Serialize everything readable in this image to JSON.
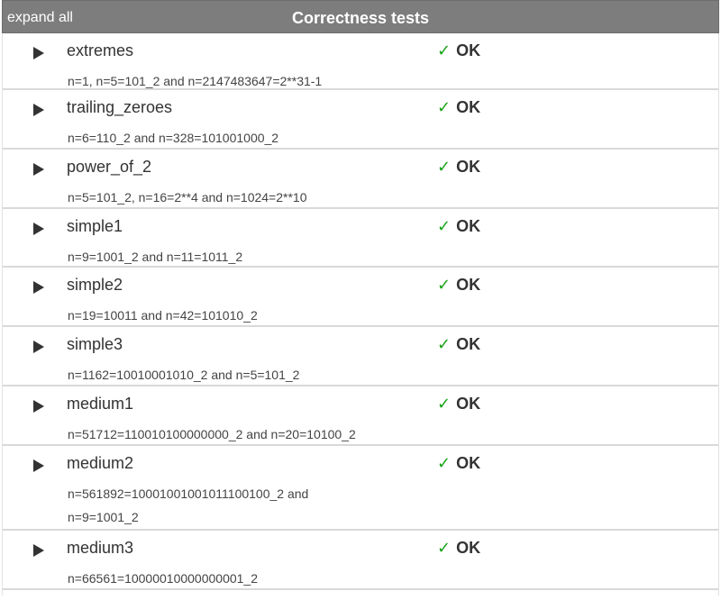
{
  "header": {
    "expand_all": "expand all",
    "title": "Correctness tests"
  },
  "check_icon": "✓",
  "tests": [
    {
      "name": "extremes",
      "desc": "n=1, n=5=101_2 and n=2147483647=2**31-1",
      "status": "OK"
    },
    {
      "name": "trailing_zeroes",
      "desc": "n=6=110_2 and n=328=101001000_2",
      "status": "OK"
    },
    {
      "name": "power_of_2",
      "desc": "n=5=101_2, n=16=2**4 and n=1024=2**10",
      "status": "OK"
    },
    {
      "name": "simple1",
      "desc": "n=9=1001_2 and n=11=1011_2",
      "status": "OK"
    },
    {
      "name": "simple2",
      "desc": "n=19=10011 and n=42=101010_2",
      "status": "OK"
    },
    {
      "name": "simple3",
      "desc": "n=1162=10010001010_2 and n=5=101_2",
      "status": "OK"
    },
    {
      "name": "medium1",
      "desc": "n=51712=110010100000000_2 and n=20=10100_2",
      "status": "OK"
    },
    {
      "name": "medium2",
      "desc": "n=561892=10001001001011100100_2 and n=9=1001_2",
      "status": "OK"
    },
    {
      "name": "medium3",
      "desc": "n=66561=10000010000000001_2",
      "status": "OK"
    }
  ],
  "colors": {
    "header_bg": "#7d7d7d",
    "ok_check": "#19a319",
    "row_divider": "#d9d9d9"
  }
}
